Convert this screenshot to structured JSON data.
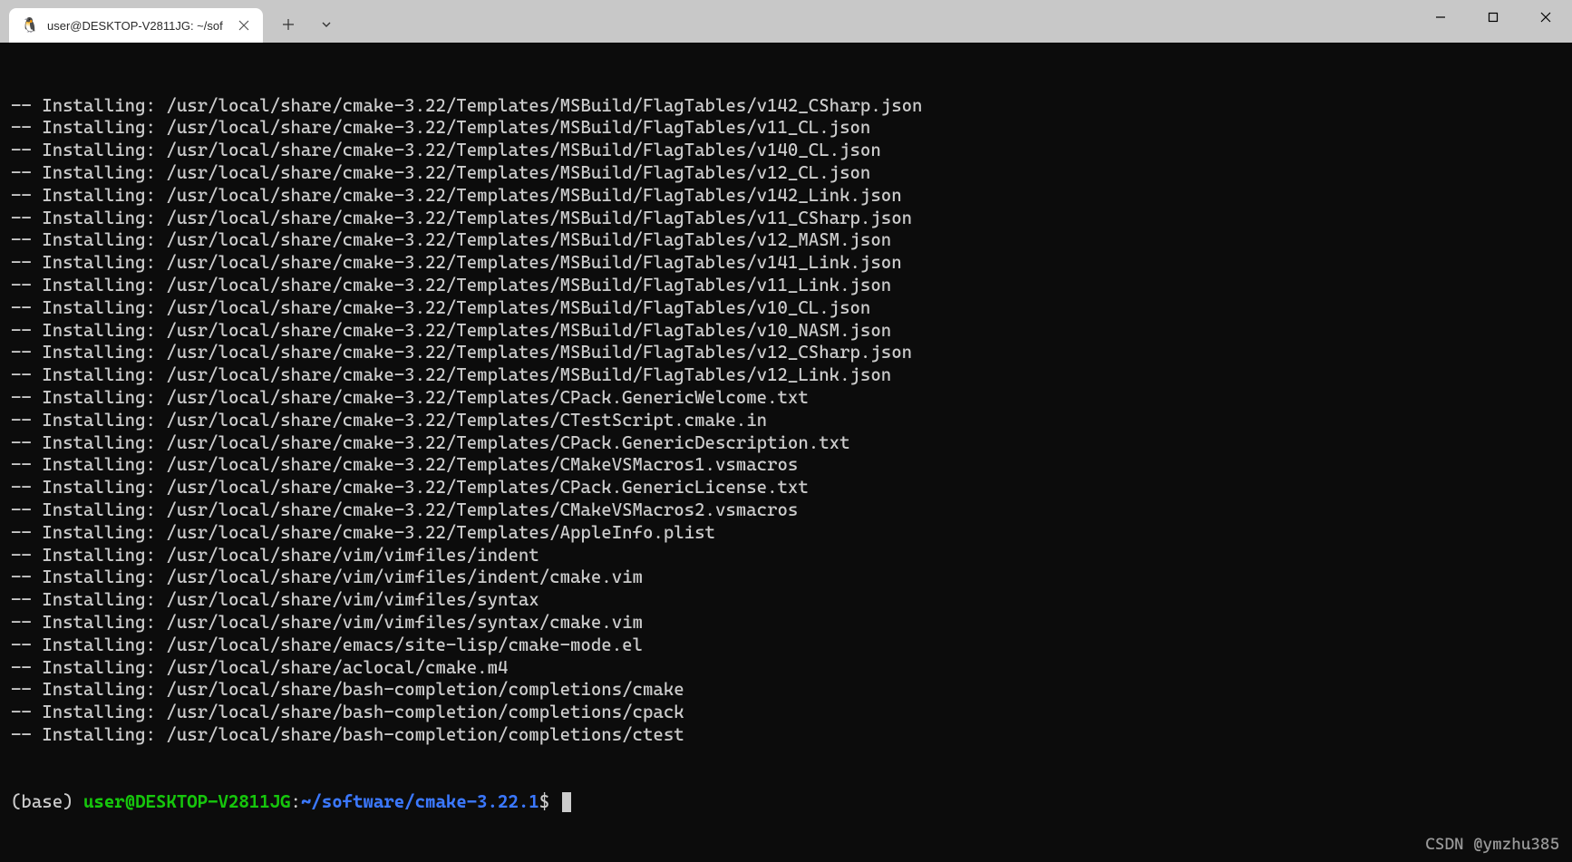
{
  "window": {
    "tab_title": "user@DESKTOP-V2811JG: ~/sof",
    "watermark": "CSDN @ymzhu385"
  },
  "prompt": {
    "base": "(base) ",
    "user_host": "user@DESKTOP-V2811JG",
    "colon": ":",
    "path": "~/software/cmake-3.22.1",
    "dollar": "$"
  },
  "lines": [
    "-- Installing: /usr/local/share/cmake-3.22/Templates/MSBuild/FlagTables/v142_CSharp.json",
    "-- Installing: /usr/local/share/cmake-3.22/Templates/MSBuild/FlagTables/v11_CL.json",
    "-- Installing: /usr/local/share/cmake-3.22/Templates/MSBuild/FlagTables/v140_CL.json",
    "-- Installing: /usr/local/share/cmake-3.22/Templates/MSBuild/FlagTables/v12_CL.json",
    "-- Installing: /usr/local/share/cmake-3.22/Templates/MSBuild/FlagTables/v142_Link.json",
    "-- Installing: /usr/local/share/cmake-3.22/Templates/MSBuild/FlagTables/v11_CSharp.json",
    "-- Installing: /usr/local/share/cmake-3.22/Templates/MSBuild/FlagTables/v12_MASM.json",
    "-- Installing: /usr/local/share/cmake-3.22/Templates/MSBuild/FlagTables/v141_Link.json",
    "-- Installing: /usr/local/share/cmake-3.22/Templates/MSBuild/FlagTables/v11_Link.json",
    "-- Installing: /usr/local/share/cmake-3.22/Templates/MSBuild/FlagTables/v10_CL.json",
    "-- Installing: /usr/local/share/cmake-3.22/Templates/MSBuild/FlagTables/v10_NASM.json",
    "-- Installing: /usr/local/share/cmake-3.22/Templates/MSBuild/FlagTables/v12_CSharp.json",
    "-- Installing: /usr/local/share/cmake-3.22/Templates/MSBuild/FlagTables/v12_Link.json",
    "-- Installing: /usr/local/share/cmake-3.22/Templates/CPack.GenericWelcome.txt",
    "-- Installing: /usr/local/share/cmake-3.22/Templates/CTestScript.cmake.in",
    "-- Installing: /usr/local/share/cmake-3.22/Templates/CPack.GenericDescription.txt",
    "-- Installing: /usr/local/share/cmake-3.22/Templates/CMakeVSMacros1.vsmacros",
    "-- Installing: /usr/local/share/cmake-3.22/Templates/CPack.GenericLicense.txt",
    "-- Installing: /usr/local/share/cmake-3.22/Templates/CMakeVSMacros2.vsmacros",
    "-- Installing: /usr/local/share/cmake-3.22/Templates/AppleInfo.plist",
    "-- Installing: /usr/local/share/vim/vimfiles/indent",
    "-- Installing: /usr/local/share/vim/vimfiles/indent/cmake.vim",
    "-- Installing: /usr/local/share/vim/vimfiles/syntax",
    "-- Installing: /usr/local/share/vim/vimfiles/syntax/cmake.vim",
    "-- Installing: /usr/local/share/emacs/site-lisp/cmake-mode.el",
    "-- Installing: /usr/local/share/aclocal/cmake.m4",
    "-- Installing: /usr/local/share/bash-completion/completions/cmake",
    "-- Installing: /usr/local/share/bash-completion/completions/cpack",
    "-- Installing: /usr/local/share/bash-completion/completions/ctest"
  ]
}
